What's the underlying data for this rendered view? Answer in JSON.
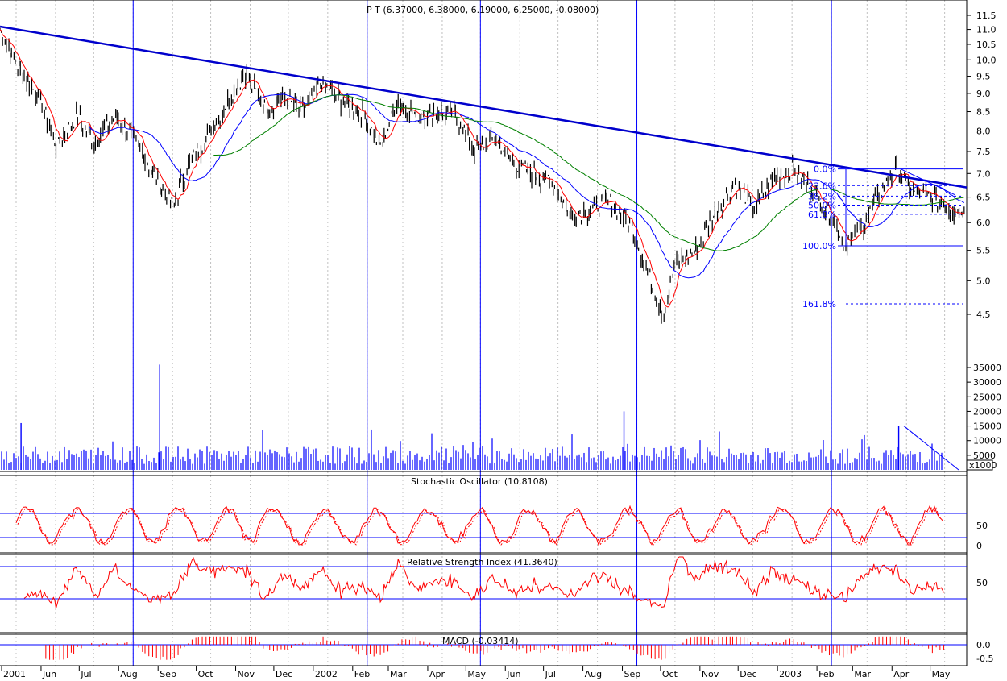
{
  "chart_data": {
    "type": "ohlc",
    "symbol": "PT",
    "title": "P T (6.37000, 6.38000, 6.19000, 6.25000, -0.08000)",
    "last_bar": {
      "open": 6.37,
      "high": 6.38,
      "low": 6.19,
      "close": 6.25,
      "change": -0.08
    },
    "price_ticks": [
      "11.5",
      "11.0",
      "10.5",
      "10.0",
      "9.5",
      "9.0",
      "8.5",
      "8.0",
      "7.5",
      "7.0",
      "6.5",
      "6.0",
      "5.5",
      "5.0",
      "4.5"
    ],
    "price_tick_values": [
      11.5,
      11.0,
      10.5,
      10.0,
      9.5,
      9.0,
      8.5,
      8.0,
      7.5,
      7.0,
      6.5,
      6.0,
      5.5,
      5.0,
      4.5
    ],
    "price_scale": "log",
    "x_months": [
      "2001",
      "Jun",
      "Jul",
      "Aug",
      "Sep",
      "Oct",
      "Nov",
      "Dec",
      "2002",
      "Feb",
      "Mar",
      "Apr",
      "May",
      "Jun",
      "Jul",
      "Aug",
      "Sep",
      "Oct",
      "Nov",
      "Dec",
      "2003",
      "Feb",
      "Mar",
      "Apr",
      "May"
    ],
    "x_range": [
      "2001-05-01",
      "2003-05-31"
    ],
    "vertical_markers": [
      "2001-08-01",
      "2002-02-01",
      "2002-05-01",
      "2002-09-01",
      "2003-02-01"
    ],
    "price_path": [
      [
        "2001-05-01",
        11.0
      ],
      [
        "2001-05-15",
        9.8
      ],
      [
        "2001-06-01",
        8.9
      ],
      [
        "2001-06-15",
        7.6
      ],
      [
        "2001-07-01",
        8.4
      ],
      [
        "2001-07-15",
        7.7
      ],
      [
        "2001-08-01",
        8.4
      ],
      [
        "2001-08-15",
        7.8
      ],
      [
        "2001-09-01",
        6.9
      ],
      [
        "2001-09-15",
        6.3
      ],
      [
        "2001-09-25",
        7.1
      ],
      [
        "2001-10-10",
        7.8
      ],
      [
        "2001-10-25",
        8.6
      ],
      [
        "2001-11-10",
        9.6
      ],
      [
        "2001-11-25",
        8.6
      ],
      [
        "2001-12-10",
        8.9
      ],
      [
        "2001-12-25",
        8.5
      ],
      [
        "2002-01-10",
        9.3
      ],
      [
        "2002-01-25",
        8.8
      ],
      [
        "2002-02-10",
        8.5
      ],
      [
        "2002-02-25",
        7.6
      ],
      [
        "2002-03-10",
        8.8
      ],
      [
        "2002-03-25",
        8.4
      ],
      [
        "2002-04-10",
        8.5
      ],
      [
        "2002-04-25",
        8.4
      ],
      [
        "2002-05-10",
        7.5
      ],
      [
        "2002-05-25",
        7.8
      ],
      [
        "2002-06-10",
        7.2
      ],
      [
        "2002-06-25",
        7.0
      ],
      [
        "2002-07-10",
        6.8
      ],
      [
        "2002-07-25",
        6.1
      ],
      [
        "2002-08-10",
        6.3
      ],
      [
        "2002-08-25",
        6.4
      ],
      [
        "2002-09-10",
        5.9
      ],
      [
        "2002-09-25",
        5.0
      ],
      [
        "2002-10-05",
        4.5
      ],
      [
        "2002-10-15",
        5.3
      ],
      [
        "2002-10-31",
        5.5
      ],
      [
        "2002-11-15",
        6.2
      ],
      [
        "2002-11-30",
        6.8
      ],
      [
        "2002-12-15",
        6.3
      ],
      [
        "2002-12-31",
        6.9
      ],
      [
        "2003-01-15",
        7.1
      ],
      [
        "2003-01-31",
        6.6
      ],
      [
        "2003-02-15",
        6.1
      ],
      [
        "2003-02-25",
        5.6
      ],
      [
        "2003-03-10",
        5.9
      ],
      [
        "2003-03-25",
        6.6
      ],
      [
        "2003-04-05",
        7.1
      ],
      [
        "2003-04-20",
        6.6
      ],
      [
        "2003-05-05",
        6.5
      ],
      [
        "2003-05-20",
        6.25
      ]
    ],
    "trendline": {
      "start": [
        "2001-05-01",
        11.1
      ],
      "end": [
        "2003-05-31",
        6.7
      ]
    },
    "fibonacci_levels": [
      {
        "label": "0.0%",
        "value": 7.1
      },
      {
        "label": "23.6%",
        "value": 6.74
      },
      {
        "label": "38.2%",
        "value": 6.52
      },
      {
        "label": "50.0%",
        "value": 6.34
      },
      {
        "label": "61.8%",
        "value": 6.16
      },
      {
        "label": "100.0%",
        "value": 5.58
      },
      {
        "label": "161.8%",
        "value": 4.65
      }
    ],
    "volume": {
      "ticks": [
        "35000",
        "30000",
        "25000",
        "20000",
        "15000",
        "10000",
        "5000"
      ],
      "tick_values": [
        35000,
        30000,
        25000,
        20000,
        15000,
        10000,
        5000
      ],
      "unit_label": "x1000",
      "spikes": [
        [
          "2001-09-01",
          36000
        ],
        [
          "2002-09-01",
          20000
        ],
        [
          "2001-05-15",
          16000
        ],
        [
          "2003-04-05",
          15000
        ]
      ]
    },
    "stochastic": {
      "title": "Stochastic Oscillator (10.8108)",
      "value": 10.8108,
      "ticks": [
        "50",
        "0"
      ],
      "tick_values": [
        50,
        0
      ],
      "levels": [
        80,
        20
      ]
    },
    "rsi": {
      "title": "Relative Strength Index (41.3640)",
      "value": 41.364,
      "ticks": [
        "50"
      ],
      "tick_values": [
        50
      ],
      "levels": [
        70,
        30
      ]
    },
    "macd": {
      "title": "MACD (-0.03414)",
      "value": -0.03414,
      "ticks": [
        "0.0",
        "-0.5"
      ],
      "tick_values": [
        0.0,
        -0.5
      ]
    },
    "colors": {
      "price": "#000000",
      "ma_short": "#ff0000",
      "ma_mid": "#0000ff",
      "ma_long": "#008000",
      "grid": "#0000ff",
      "indicator": "#ff0000",
      "volume": "#0000ff"
    }
  }
}
